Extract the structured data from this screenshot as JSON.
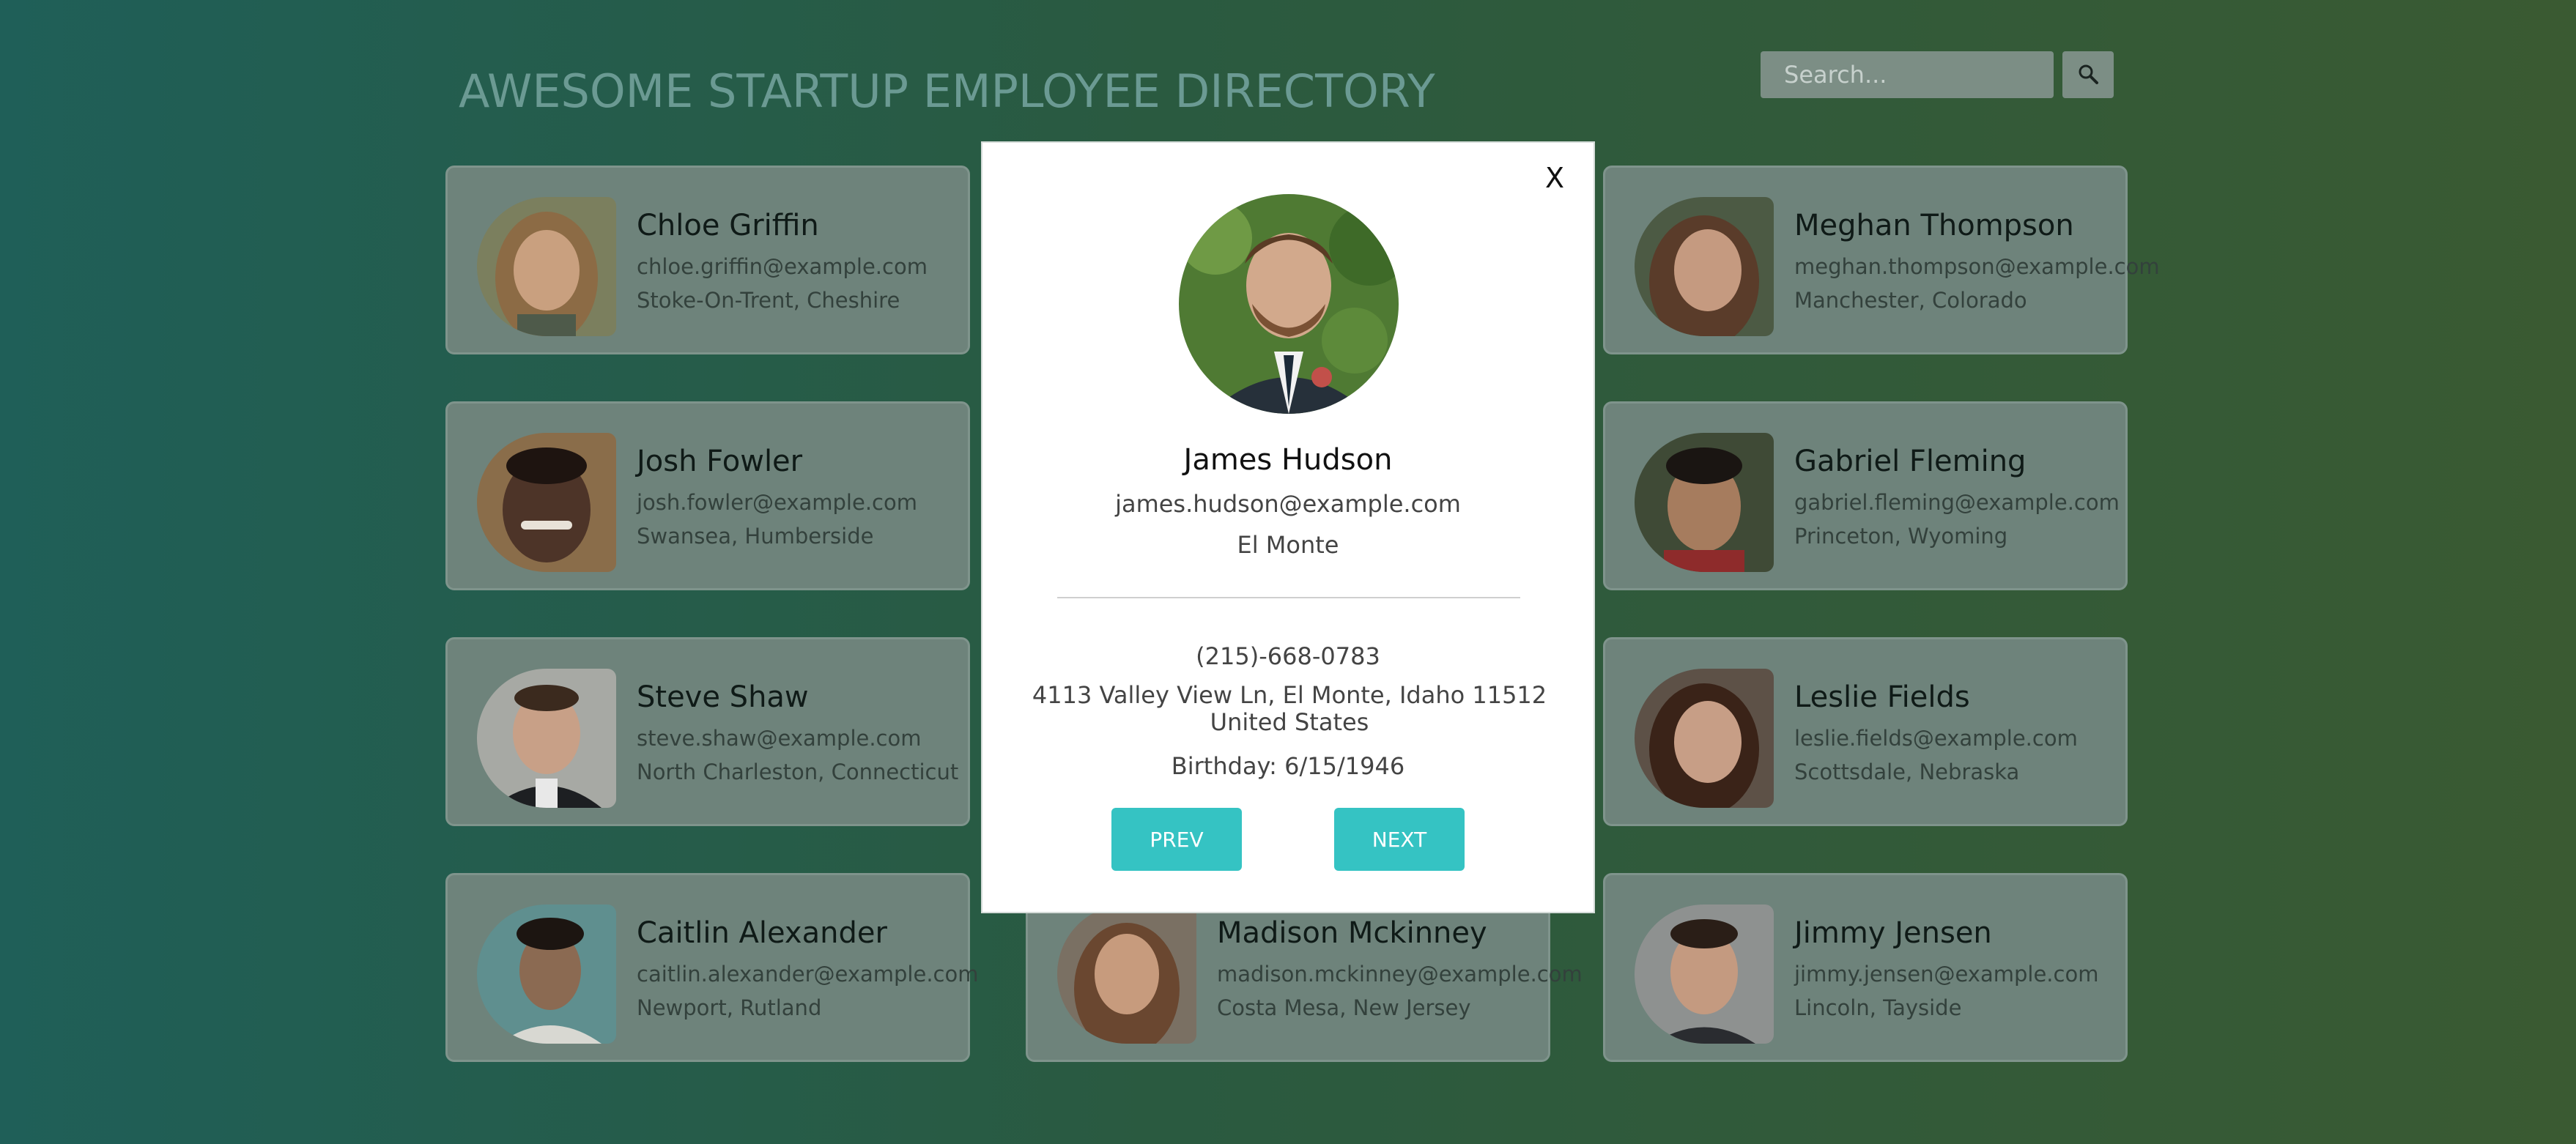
{
  "header": {
    "title": "AWESOME STARTUP EMPLOYEE DIRECTORY"
  },
  "search": {
    "placeholder": "Search...",
    "icon": "search-icon"
  },
  "employees": [
    {
      "name": "Chloe Griffin",
      "email": "chloe.griffin@example.com",
      "location": "Stoke-On-Trent, Cheshire",
      "skin": "#c9a07f",
      "hair": "#8c6b45",
      "bg": "#7b7f5e"
    },
    {
      "name": "",
      "email": "",
      "location": "",
      "skin": "#b08a6e",
      "hair": "#3a2a20",
      "bg": "#6b7a70"
    },
    {
      "name": "Meghan Thompson",
      "email": "meghan.thompson@example.com",
      "location": "Manchester, Colorado",
      "skin": "#c59a80",
      "hair": "#5a3c2a",
      "bg": "#4c5a44"
    },
    {
      "name": "Josh Fowler",
      "email": "josh.fowler@example.com",
      "location": "Swansea, Humberside",
      "skin": "#4d3428",
      "hair": "#1e1410",
      "bg": "#8a6d4a"
    },
    {
      "name": "",
      "email": "",
      "location": "",
      "skin": "#b08a6e",
      "hair": "#3a2a20",
      "bg": "#6b7a70"
    },
    {
      "name": "Gabriel Fleming",
      "email": "gabriel.fleming@example.com",
      "location": "Princeton, Wyoming",
      "skin": "#a67c5e",
      "hair": "#1a1512",
      "bg": "#3f4a36"
    },
    {
      "name": "Steve Shaw",
      "email": "steve.shaw@example.com",
      "location": "North Charleston, Connecticut",
      "skin": "#c8a087",
      "hair": "#3b2a1e",
      "bg": "#a7a9a4"
    },
    {
      "name": "",
      "email": "",
      "location": "",
      "skin": "#b08a6e",
      "hair": "#3a2a20",
      "bg": "#6b7a70"
    },
    {
      "name": "Leslie Fields",
      "email": "leslie.fields@example.com",
      "location": "Scottsdale, Nebraska",
      "skin": "#c79e86",
      "hair": "#3a2318",
      "bg": "#5d5147"
    },
    {
      "name": "Caitlin Alexander",
      "email": "caitlin.alexander@example.com",
      "location": "Newport, Rutland",
      "skin": "#8b6a52",
      "hair": "#1c1511",
      "bg": "#5f8f8f"
    },
    {
      "name": "Madison Mckinney",
      "email": "madison.mckinney@example.com",
      "location": "Costa Mesa, New Jersey",
      "skin": "#c79b7d",
      "hair": "#6a4730",
      "bg": "#7a7063"
    },
    {
      "name": "Jimmy Jensen",
      "email": "jimmy.jensen@example.com",
      "location": "Lincoln, Tayside",
      "skin": "#c49a80",
      "hair": "#2a1e17",
      "bg": "#8e9190"
    }
  ],
  "modal": {
    "close_label": "X",
    "name": "James Hudson",
    "email": "james.hudson@example.com",
    "city": "El Monte",
    "phone": "(215)-668-0783",
    "address": "4113 Valley View Ln, El Monte, Idaho 11512 United States",
    "birthday": "Birthday: 6/15/1946",
    "prev_label": "PREV",
    "next_label": "NEXT",
    "accent_color": "#35c3c3"
  },
  "colors": {
    "card_bg": "#6e837b",
    "title_color": "#6b9a93"
  }
}
